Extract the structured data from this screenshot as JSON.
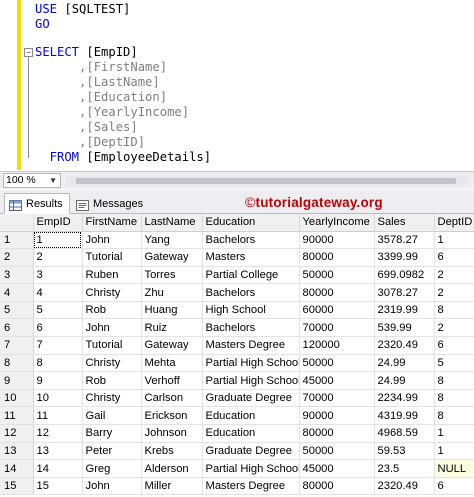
{
  "editor": {
    "lines": [
      {
        "kw": "USE",
        "rest": " [SQLTEST]"
      },
      {
        "kw": "GO",
        "rest": ""
      },
      {
        "kw": "",
        "rest": ""
      },
      {
        "kw": "SELECT",
        "rest": " [EmpID]"
      },
      {
        "kw": "",
        "rest": "      ,[FirstName]"
      },
      {
        "kw": "",
        "rest": "      ,[LastName]"
      },
      {
        "kw": "",
        "rest": "      ,[Education]"
      },
      {
        "kw": "",
        "rest": "      ,[YearlyIncome]"
      },
      {
        "kw": "",
        "rest": "      ,[Sales]"
      },
      {
        "kw": "",
        "rest": "      ,[DeptID]"
      },
      {
        "kw": "  FROM",
        "rest": " [EmployeeDetails]"
      }
    ],
    "collapse_symbol": "−"
  },
  "zoom": {
    "value": "100 %"
  },
  "tabs": [
    {
      "label": "Results",
      "active": true,
      "icon": "results-grid-icon"
    },
    {
      "label": "Messages",
      "active": false,
      "icon": "messages-icon"
    }
  ],
  "brand": {
    "symbol": "©",
    "text": "tutorialgateway.org",
    "color": "#c00000"
  },
  "table": {
    "columns": [
      "EmpID",
      "FirstName",
      "LastName",
      "Education",
      "YearlyIncome",
      "Sales",
      "DeptID"
    ],
    "rows": [
      [
        "1",
        "1",
        "John",
        "Yang",
        "Bachelors",
        "90000",
        "3578.27",
        "1"
      ],
      [
        "2",
        "2",
        "Tutorial",
        "Gateway",
        "Masters",
        "80000",
        "3399.99",
        "6"
      ],
      [
        "3",
        "3",
        "Ruben",
        "Torres",
        "Partial College",
        "50000",
        "699.0982",
        "2"
      ],
      [
        "4",
        "4",
        "Christy",
        "Zhu",
        "Bachelors",
        "80000",
        "3078.27",
        "2"
      ],
      [
        "5",
        "5",
        "Rob",
        "Huang",
        "High School",
        "60000",
        "2319.99",
        "8"
      ],
      [
        "6",
        "6",
        "John",
        "Ruiz",
        "Bachelors",
        "70000",
        "539.99",
        "2"
      ],
      [
        "7",
        "7",
        "Tutorial",
        "Gateway",
        "Masters Degree",
        "120000",
        "2320.49",
        "6"
      ],
      [
        "8",
        "8",
        "Christy",
        "Mehta",
        "Partial High School",
        "50000",
        "24.99",
        "5"
      ],
      [
        "9",
        "9",
        "Rob",
        "Verhoff",
        "Partial High School",
        "45000",
        "24.99",
        "8"
      ],
      [
        "10",
        "10",
        "Christy",
        "Carlson",
        "Graduate Degree",
        "70000",
        "2234.99",
        "8"
      ],
      [
        "11",
        "11",
        "Gail",
        "Erickson",
        "Education",
        "90000",
        "4319.99",
        "8"
      ],
      [
        "12",
        "12",
        "Barry",
        "Johnson",
        "Education",
        "80000",
        "4968.59",
        "1"
      ],
      [
        "13",
        "13",
        "Peter",
        "Krebs",
        "Graduate Degree",
        "50000",
        "59.53",
        "1"
      ],
      [
        "14",
        "14",
        "Greg",
        "Alderson",
        "Partial High School",
        "45000",
        "23.5",
        "NULL"
      ],
      [
        "15",
        "15",
        "John",
        "Miller",
        "Masters Degree",
        "80000",
        "2320.49",
        "6"
      ]
    ]
  },
  "colors": {
    "keyword": "#0000ff",
    "null_cell": "#ffffe1",
    "gutter": "#f2e100"
  }
}
